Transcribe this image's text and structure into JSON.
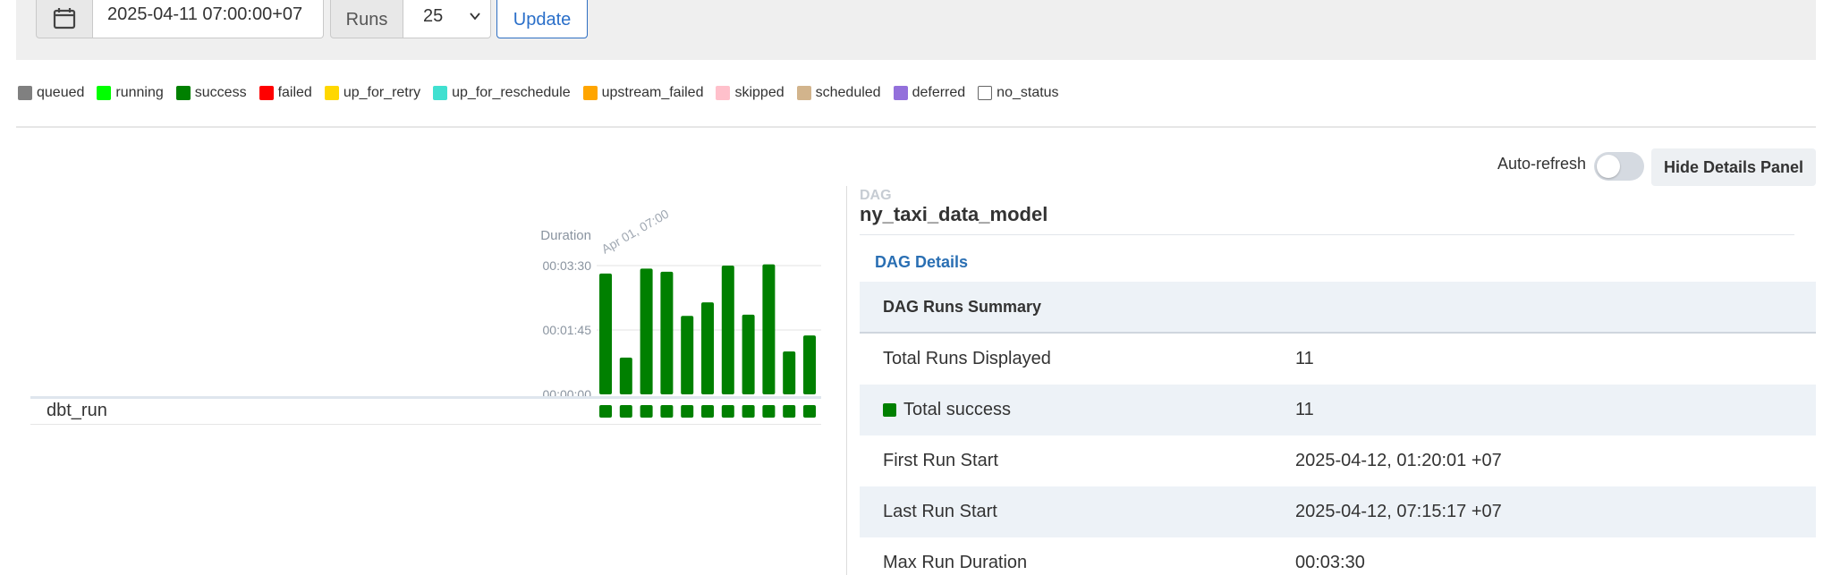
{
  "filters": {
    "base_date": "2025-04-11 07:00:00+07",
    "runs_label": "Runs",
    "runs_value": "25",
    "update_label": "Update"
  },
  "legend": [
    {
      "label": "queued",
      "color": "#808080"
    },
    {
      "label": "running",
      "color": "#00ff00"
    },
    {
      "label": "success",
      "color": "#008000"
    },
    {
      "label": "failed",
      "color": "#ff0000"
    },
    {
      "label": "up_for_retry",
      "color": "#ffd700"
    },
    {
      "label": "up_for_reschedule",
      "color": "#40e0d0"
    },
    {
      "label": "upstream_failed",
      "color": "#ffa500"
    },
    {
      "label": "skipped",
      "color": "#ffc0cb"
    },
    {
      "label": "scheduled",
      "color": "#d2b48c"
    },
    {
      "label": "deferred",
      "color": "#9370db"
    },
    {
      "label": "no_status",
      "color": "#ffffff"
    }
  ],
  "toolbar": {
    "auto_refresh_label": "Auto-refresh",
    "auto_refresh_on": false,
    "hide_panel_label": "Hide Details Panel"
  },
  "grid": {
    "duration_label": "Duration",
    "first_run_label": "Apr 01, 07:00",
    "task_name": "dbt_run"
  },
  "chart_data": {
    "type": "bar",
    "ylabel": "Duration",
    "y_ticks": [
      "00:00:00",
      "00:01:45",
      "00:03:30"
    ],
    "ylim_seconds": [
      0,
      210
    ],
    "bar_color": "#008000",
    "values_seconds": [
      197,
      60,
      205,
      200,
      128,
      150,
      210,
      130,
      212,
      70,
      96
    ]
  },
  "details": {
    "kicker": "DAG",
    "dag_id": "ny_taxi_data_model",
    "details_link": "DAG Details",
    "summary_title": "DAG Runs Summary",
    "rows": [
      {
        "key": "Total Runs Displayed",
        "value": "11"
      },
      {
        "key": "Total success",
        "value": "11",
        "status_color": "#008000"
      },
      {
        "key": "First Run Start",
        "value": "2025-04-12, 01:20:01 +07"
      },
      {
        "key": "Last Run Start",
        "value": "2025-04-12, 07:15:17 +07"
      },
      {
        "key": "Max Run Duration",
        "value": "00:03:30"
      }
    ]
  }
}
